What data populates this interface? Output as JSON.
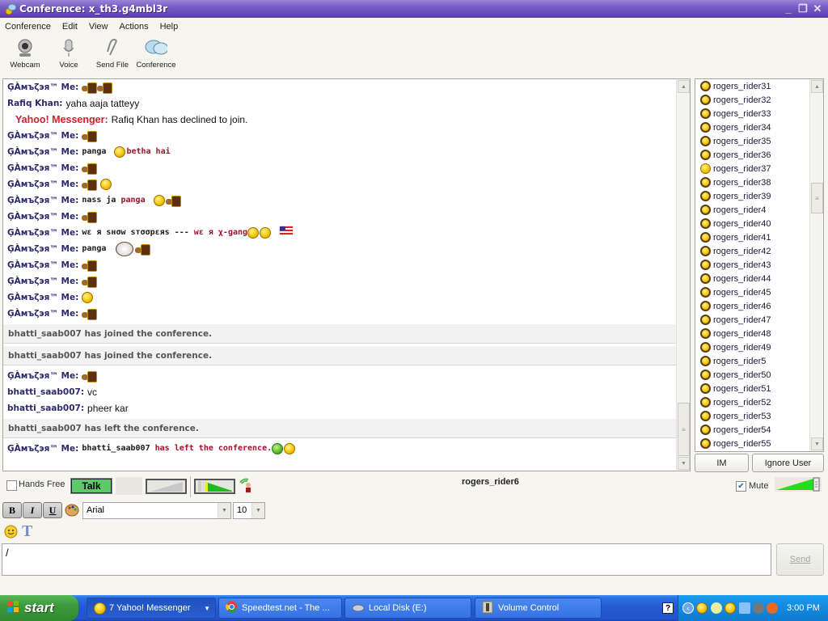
{
  "window": {
    "title": "Conference: x_th3.g4mbl3r",
    "controls": {
      "minimize": "_",
      "restore": "❐",
      "close": "✕"
    }
  },
  "menu": [
    "Conference",
    "Edit",
    "View",
    "Actions",
    "Help"
  ],
  "toolbar": [
    {
      "label": "Webcam",
      "icon": "webcam-icon"
    },
    {
      "label": "Voice",
      "icon": "microphone-icon"
    },
    {
      "label": "Send File",
      "icon": "paperclip-icon"
    },
    {
      "label": "Conference",
      "icon": "conference-bubbles-icon"
    }
  ],
  "chat": {
    "messages": [
      {
        "type": "msg",
        "nick": "ĢÀмъζэя™ Me:",
        "content": [
          {
            "emoji": "cup"
          },
          {
            "emoji": "cup"
          }
        ]
      },
      {
        "type": "msg",
        "nick": "Rafiq Khan:",
        "content": [
          {
            "text": "yaha  aaja  tatteyy"
          }
        ]
      },
      {
        "type": "system",
        "nick": "Yahoo! Messenger:",
        "content": [
          {
            "text": "Rafiq Khan has declined to join."
          }
        ]
      },
      {
        "type": "msg",
        "nick": "ĢÀмъζэя™ Me:",
        "content": [
          {
            "emoji": "cup"
          }
        ]
      },
      {
        "type": "msg",
        "nick": "ĢÀмъζэя™ Me:",
        "content": [
          {
            "fancy": "panga "
          },
          {
            "emoji": "laugh"
          },
          {
            "fancy_red": "betha hai"
          }
        ]
      },
      {
        "type": "msg",
        "nick": "ĢÀмъζэя™ Me:",
        "content": [
          {
            "emoji": "cup"
          }
        ]
      },
      {
        "type": "msg",
        "nick": "ĢÀмъζэя™ Me:",
        "content": [
          {
            "emoji": "cup"
          },
          {
            "emoji": "laugh"
          }
        ]
      },
      {
        "type": "msg",
        "nick": "ĢÀмъζэя™ Me:",
        "content": [
          {
            "fancy": "nass ja "
          },
          {
            "fancy_red": "panga "
          },
          {
            "emoji": "wink"
          },
          {
            "emoji": "cup"
          }
        ]
      },
      {
        "type": "msg",
        "nick": "ĢÀмъζэя™ Me:",
        "content": [
          {
            "emoji": "cup"
          }
        ]
      },
      {
        "type": "msg",
        "nick": "ĢÀмъζэя™ Me:",
        "content": [
          {
            "fancy": "wε я sнσw sтσσpεяs --- "
          },
          {
            "fancy_red": "wε я χ-gang"
          },
          {
            "emoji": "cool"
          },
          {
            "emoji": "peace"
          },
          {
            "emoji": "flag"
          }
        ]
      },
      {
        "type": "msg",
        "nick": "ĢÀмъζэя™ Me:",
        "content": [
          {
            "fancy": "panga "
          },
          {
            "emoji": "puppy"
          },
          {
            "emoji": "cup"
          }
        ]
      },
      {
        "type": "msg",
        "nick": "ĢÀмъζэя™ Me:",
        "content": [
          {
            "emoji": "cup"
          }
        ]
      },
      {
        "type": "msg",
        "nick": "ĢÀмъζэя™ Me:",
        "content": [
          {
            "emoji": "cup"
          }
        ]
      },
      {
        "type": "msg",
        "nick": "ĢÀмъζэя™ Me:",
        "content": [
          {
            "emoji": "smile"
          }
        ]
      },
      {
        "type": "msg",
        "nick": "ĢÀмъζэя™ Me:",
        "content": [
          {
            "emoji": "cup"
          }
        ]
      },
      {
        "type": "event",
        "text": "bhatti_saab007 has joined the conference."
      },
      {
        "type": "event",
        "text": "bhatti_saab007 has joined the conference."
      },
      {
        "type": "msg",
        "nick": "ĢÀмъζэя™ Me:",
        "content": [
          {
            "emoji": "cup"
          }
        ]
      },
      {
        "type": "msg",
        "nick": "bhatti_saab007:",
        "content": [
          {
            "text": "vc"
          }
        ]
      },
      {
        "type": "msg",
        "nick": "bhatti_saab007:",
        "content": [
          {
            "text": "pheer kar"
          }
        ]
      },
      {
        "type": "event",
        "text": "bhatti_saab007 has left the conference."
      },
      {
        "type": "msg",
        "nick": "ĢÀмъζэя™ Me:",
        "content": [
          {
            "fancy": "bhatti_saab007 "
          },
          {
            "fancy_red": "has left the conference."
          },
          {
            "emoji": "sick"
          },
          {
            "emoji": "tongue"
          }
        ]
      }
    ],
    "scroll_position": 0.95
  },
  "users": [
    "rogers_rider31",
    "rogers_rider32",
    "rogers_rider33",
    "rogers_rider34",
    "rogers_rider35",
    "rogers_rider36",
    "rogers_rider37",
    "rogers_rider38",
    "rogers_rider39",
    "rogers_rider4",
    "rogers_rider40",
    "rogers_rider41",
    "rogers_rider42",
    "rogers_rider43",
    "rogers_rider44",
    "rogers_rider45",
    "rogers_rider46",
    "rogers_rider47",
    "rogers_rider48",
    "rogers_rider49",
    "rogers_rider5",
    "rogers_rider50",
    "rogers_rider51",
    "rogers_rider52",
    "rogers_rider53",
    "rogers_rider54",
    "rogers_rider55"
  ],
  "user_buttons": {
    "im": "IM",
    "ignore": "Ignore User"
  },
  "voice": {
    "hands_free_label": "Hands Free",
    "hands_free_checked": false,
    "talk_label": "Talk",
    "speaker": "rogers_rider6",
    "mute_label": "Mute",
    "mute_checked": true,
    "volume_level": 1.0
  },
  "format": {
    "bold": "B",
    "italic": "I",
    "underline": "U",
    "font": "Arial",
    "size": "10"
  },
  "input": {
    "value": "/"
  },
  "send_label": "Send",
  "taskbar": {
    "start_label": "start",
    "items": [
      {
        "label": "7 Yahoo! Messenger",
        "active": true
      },
      {
        "label": "Speedtest.net - The ...",
        "active": false
      },
      {
        "label": "Local Disk (E:)",
        "active": false
      },
      {
        "label": "Volume Control",
        "active": false
      }
    ],
    "clock": "3:00 PM"
  },
  "colors": {
    "title_purple": "#6a4bb8",
    "system_red": "#d11e2a",
    "nick_navy": "#2c2a6a",
    "talk_green": "#5fc86a",
    "taskbar_blue": "#2458d0"
  }
}
